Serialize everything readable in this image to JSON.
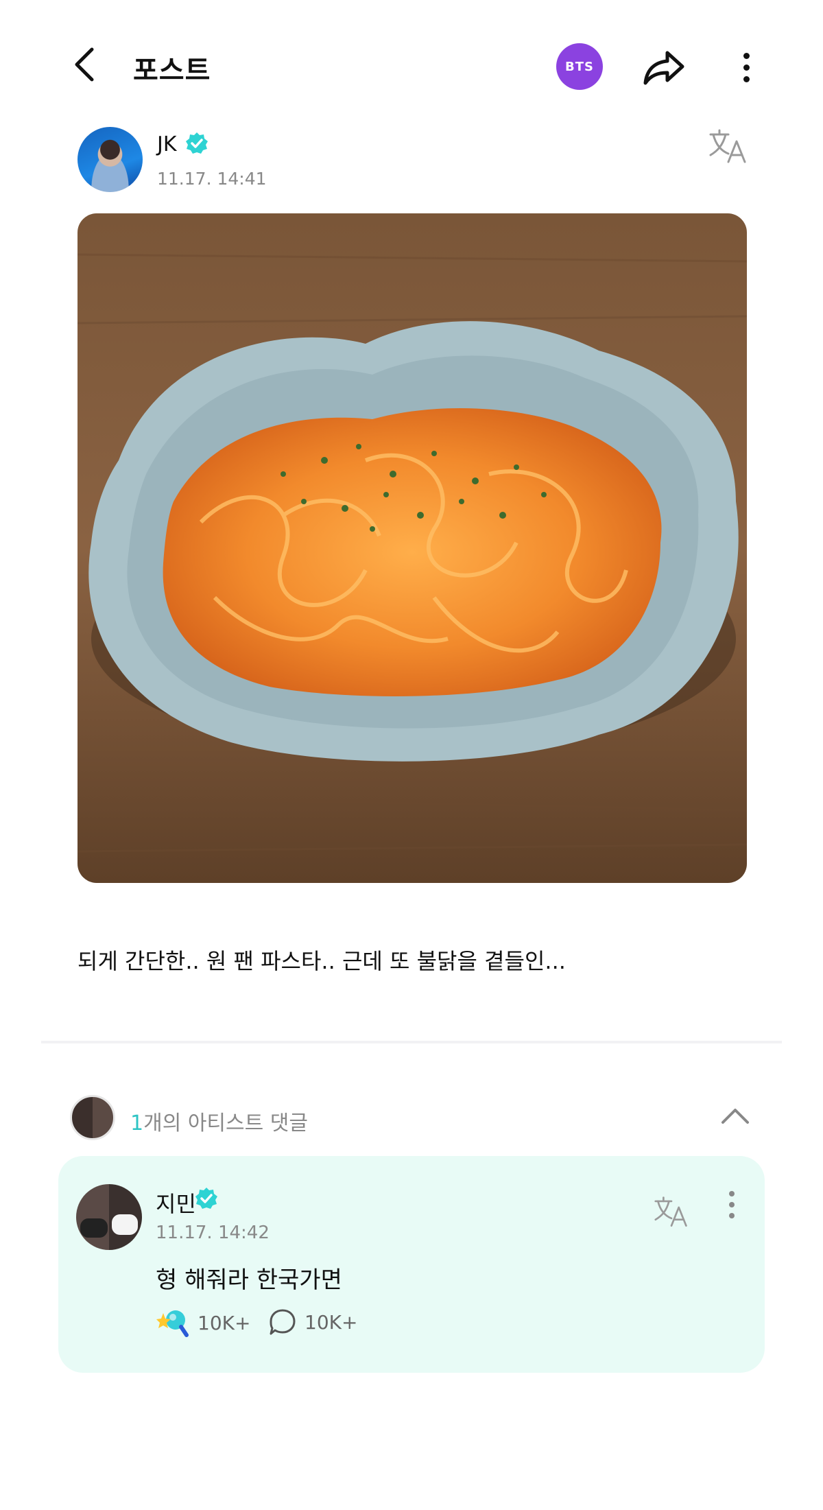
{
  "header": {
    "title": "포스트",
    "badge": "BTS",
    "badge_color": "#8b42e0",
    "icons": [
      "chevron-left-icon",
      "share-icon",
      "more-vertical-icon"
    ]
  },
  "post": {
    "author": "JK",
    "time": "11.17. 14:41",
    "caption": "되게 간단한.. 원 팬 파스타.. 근데 또 불닭을 곁들인..."
  },
  "comments_section": {
    "count": "1",
    "count_suffix": "개의 아티스트 댓글"
  },
  "comment": {
    "author": "지민",
    "time": "11.17. 14:42",
    "text": "형 해줘라 한국가면",
    "likes": "10K+",
    "replies": "10K+"
  },
  "colors": {
    "verified": "#2ed3d3",
    "accent": "#2ec4c4",
    "comment_bg": "#e8fbf6"
  }
}
